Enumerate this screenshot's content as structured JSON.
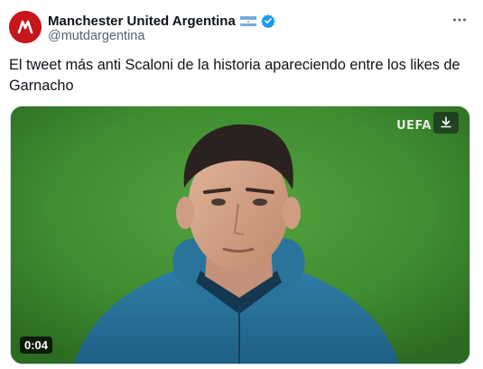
{
  "author": {
    "display_name": "Manchester United Argentina",
    "handle": "@mutdargentina",
    "flag_icon": "argentina-flag-icon",
    "verified_icon": "verified-badge-icon",
    "verified_color": "#1d9bf0",
    "avatar_color": "#c7151b"
  },
  "tweet": {
    "text": "El tweet más anti Scaloni de la historia apareciendo entre los likes de Garnacho"
  },
  "media": {
    "type": "video",
    "duration": "0:04",
    "watermark": "UEFA",
    "download_icon": "download-icon"
  },
  "menu": {
    "more_icon": "more-options-icon"
  }
}
